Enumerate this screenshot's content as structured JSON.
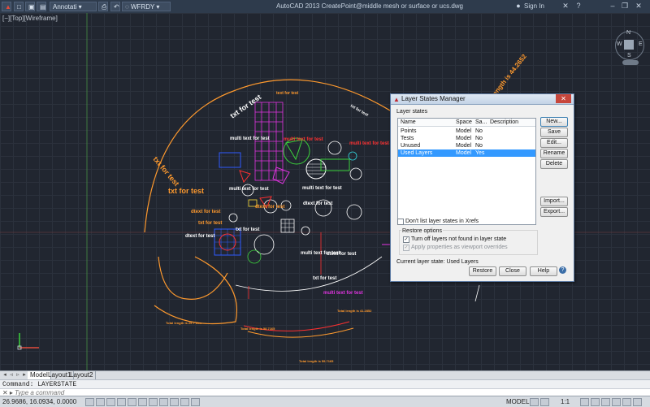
{
  "app": {
    "title": "AutoCAD 2013     CreatePoint@middle mesh or surface or ucs.dwg",
    "quick_access": {
      "workspace": "Annotati",
      "layer": "WFRDY"
    },
    "sign_in": "Sign In",
    "view_label": "[−][Top][Wireframe]"
  },
  "viewcube": {
    "north": "N",
    "south": "S",
    "west": "W",
    "east": "E"
  },
  "drawing": {
    "texts": {
      "arc_top": "txt for test",
      "arc_length": "arc length is 44.2652",
      "arc_left": "txt for test",
      "left_big": "txt for test",
      "multi1": "multi text for test",
      "multi2": "multi text for test",
      "multi3": "multi text for test",
      "multi4": "multi text for test",
      "multi5": "multi text for test",
      "multi6": "multi text for test",
      "multi7": "multi text for test",
      "dtext1": "dtext for test",
      "dtext2": "dtext for test",
      "dtext3": "dtext for test",
      "dtext4": "dtext for test",
      "dtext5": "dtext for test",
      "txt1": "txt for test",
      "txt2": "txt for test",
      "txt3": "txt for test",
      "txt4": "txt for test",
      "total1": "Total length is 29.7 mm",
      "total2": "Total length is 58.7165",
      "total3": "Total length is 41.2852",
      "total4": "Total length is 59.7165",
      "small_arc": "text for test"
    }
  },
  "tabs": {
    "model": "Model",
    "layout1": "Layout1",
    "layout2": "Layout2"
  },
  "command": {
    "history": "Command:  LAYERSTATE",
    "placeholder": "Type a command"
  },
  "status": {
    "coords": "26.9686, 16.0934, 0.0000",
    "model": "MODEL",
    "scale": "1:1"
  },
  "dialog": {
    "title": "Layer States Manager",
    "group_label": "Layer states",
    "columns": [
      "Name",
      "Space",
      "Sa...",
      "Description"
    ],
    "rows": [
      {
        "name": "Points",
        "space": "Model",
        "saved": "No",
        "desc": ""
      },
      {
        "name": "Tests",
        "space": "Model",
        "saved": "No",
        "desc": ""
      },
      {
        "name": "Unused",
        "space": "Model",
        "saved": "No",
        "desc": ""
      },
      {
        "name": "Used Layers",
        "space": "Model",
        "saved": "Yes",
        "desc": ""
      }
    ],
    "buttons": {
      "new": "New...",
      "save": "Save",
      "edit": "Edit...",
      "rename": "Rename",
      "delete": "Delete",
      "import": "Import...",
      "export": "Export...",
      "restore": "Restore",
      "close": "Close",
      "help": "Help"
    },
    "xrefs_checkbox": "Don't list layer states in Xrefs",
    "restore_options": "Restore options",
    "opt_turn_off": "Turn off layers not found in layer state",
    "opt_apply": "Apply properties as viewport overrides",
    "current_state": "Current layer state:  Used Layers"
  },
  "colors": {
    "orange": "#ff9a2e",
    "white": "#ffffff",
    "magenta": "#e234e2",
    "red": "#ff3030",
    "green": "#3cd23c",
    "blue": "#2f5bff",
    "cyan": "#32d3dc",
    "yellow": "#ffe23a",
    "dialog_selection": "#3399ff"
  }
}
